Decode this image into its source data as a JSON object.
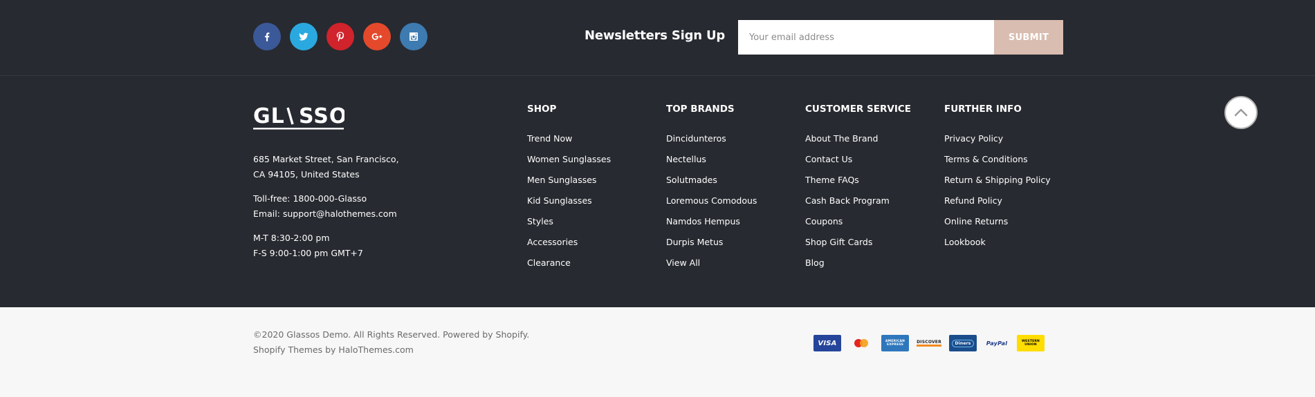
{
  "social": [
    {
      "name": "facebook-icon",
      "label": "f",
      "color": "#3b5998"
    },
    {
      "name": "twitter-icon",
      "label": "t",
      "color": "#2aa9e0"
    },
    {
      "name": "pinterest-icon",
      "label": "p",
      "color": "#d0232b"
    },
    {
      "name": "google-plus-icon",
      "label": "G+",
      "color": "#e4492c"
    },
    {
      "name": "instagram-icon",
      "label": "ig",
      "color": "#3d7bb1"
    }
  ],
  "newsletter": {
    "title": "Newsletters Sign Up",
    "placeholder": "Your email address",
    "submit_label": "SUBMIT"
  },
  "brand": {
    "logo_text": "GLASSO",
    "address_line1": "685 Market Street, San Francisco,",
    "address_line2": "CA 94105, United States",
    "tollfree": "Toll-free: 1800-000-Glasso",
    "email": "Email: support@halothemes.com",
    "hours1": "M-T 8:30-2:00 pm",
    "hours2": "F-S 9:00-1:00 pm GMT+7"
  },
  "columns": [
    {
      "title": "SHOP",
      "links": [
        "Trend Now",
        "Women Sunglasses",
        "Men Sunglasses",
        "Kid Sunglasses",
        "Styles",
        "Accessories",
        "Clearance"
      ]
    },
    {
      "title": "TOP BRANDS",
      "links": [
        "Dincidunteros",
        "Nectellus",
        "Solutmades",
        "Loremous Comodous",
        "Namdos Hempus",
        "Durpis Metus",
        "View All"
      ]
    },
    {
      "title": "CUSTOMER SERVICE",
      "links": [
        "About The Brand",
        "Contact Us",
        "Theme FAQs",
        "Cash Back Program",
        "Coupons",
        "Shop Gift Cards",
        "Blog"
      ]
    },
    {
      "title": "FURTHER INFO",
      "links": [
        "Privacy Policy",
        "Terms & Conditions",
        "Return & Shipping Policy",
        "Refund Policy",
        "Online Returns",
        "Lookbook"
      ]
    }
  ],
  "copyright": {
    "line1": "©2020 Glassos Demo. All Rights Reserved. Powered by Shopify.",
    "line2": "Shopify Themes by HaloThemes.com"
  },
  "payments": [
    {
      "name": "visa-icon",
      "label": "VISA",
      "bg": "#25459b",
      "fg": "#ffffff"
    },
    {
      "name": "mastercard-icon",
      "label": "",
      "bg": "#f7f7f7",
      "fg": "#000000"
    },
    {
      "name": "amex-icon",
      "label": "AMERICAN EXPRESS",
      "bg": "#2e77bc",
      "fg": "#ffffff"
    },
    {
      "name": "discover-icon",
      "label": "DISCOVER",
      "bg": "#f7f7f7",
      "fg": "#222222"
    },
    {
      "name": "diners-icon",
      "label": "Diners",
      "bg": "#1a4d8c",
      "fg": "#ffffff"
    },
    {
      "name": "paypal-icon",
      "label": "PayPal",
      "bg": "#f7f7f7",
      "fg": "#1f3c88"
    },
    {
      "name": "western-union-icon",
      "label": "WESTERN UNION",
      "bg": "#ffdd00",
      "fg": "#000000"
    }
  ]
}
